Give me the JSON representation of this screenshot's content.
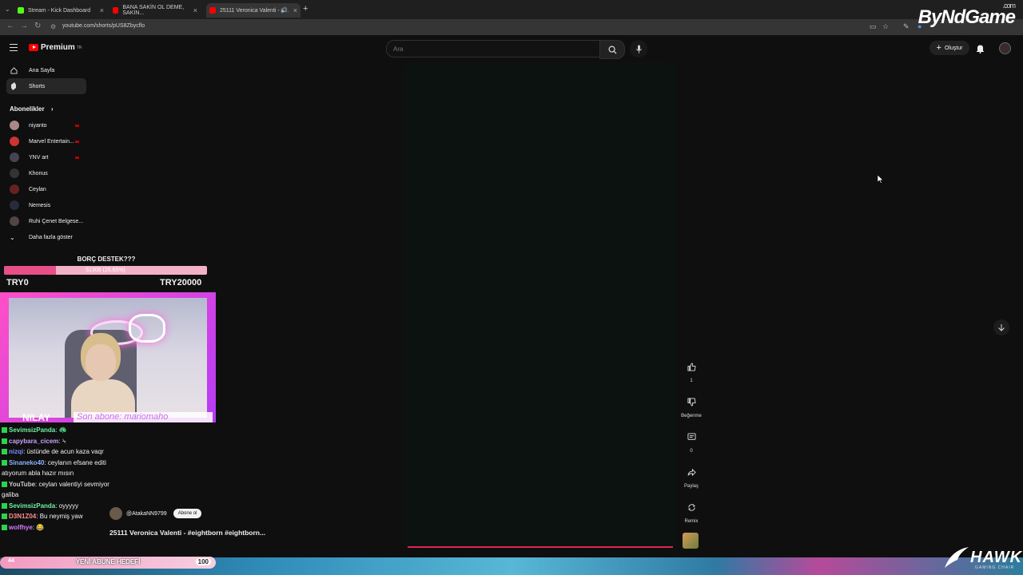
{
  "browser": {
    "tabs": [
      {
        "title": "Stream - Kick Dashboard",
        "fav_color": "#53fc18",
        "close": "×"
      },
      {
        "title": "BANA SAKİN OL DEME, SAKİN...",
        "fav_color": "#ff0000",
        "close": "×"
      },
      {
        "title": "25111 Veronica Valenti - #...",
        "fav_color": "#ff0000",
        "close": "×"
      }
    ],
    "new_tab": "+",
    "url": "youtube.com/shorts/pUS8Zbycflo"
  },
  "overlay_brand": {
    "main": "ByNdGame",
    "sub": ".com"
  },
  "youtube": {
    "logo_text": "Premium",
    "logo_sup": "TR",
    "search_placeholder": "Ara",
    "create_label": "Oluştur",
    "nav": [
      {
        "label": "Ana Sayfa",
        "icon": "home-icon"
      },
      {
        "label": "Shorts",
        "icon": "shorts-icon"
      }
    ],
    "subs_header": "Abonelikler",
    "subs_chevron": "›",
    "subscriptions": [
      {
        "name": "niyanto",
        "color": "#a88",
        "live": true
      },
      {
        "name": "Marvel Entertain...",
        "color": "#c33",
        "live": true
      },
      {
        "name": "YNV art",
        "color": "#445",
        "live": true
      },
      {
        "name": "Khonus",
        "color": "#333",
        "live": false
      },
      {
        "name": "Ceylan",
        "color": "#622",
        "live": false
      },
      {
        "name": "Nemesis",
        "color": "#2a2a3a",
        "live": false
      },
      {
        "name": "Ruhi Çenet Belgese...",
        "color": "#544",
        "live": false
      }
    ],
    "show_more": "Daha fazla göster"
  },
  "donation": {
    "title": "BORÇ DESTEK???",
    "progress_text": "51306 (25.65%)",
    "fraction": 0.2565,
    "min": "TRY0",
    "max": "TRY20000"
  },
  "cam": {
    "name": "NILAY",
    "latest_sub": "Son abone: mariomaho"
  },
  "chat": [
    {
      "user": "SevimsizPanda",
      "color": "#6ef0a5",
      "msg": ": 🦚"
    },
    {
      "user": "capybara_cicem",
      "color": "#c8a0ff",
      "msg": ": ⍀"
    },
    {
      "user": "nizqi",
      "color": "#7c8bff",
      "msg": ": üstünde de acun kaza vaqr"
    },
    {
      "user": "Sinaneko40",
      "color": "#8fb2ff",
      "msg": ": ceylanın efsane editi"
    },
    {
      "user": "",
      "color": "#fff",
      "msg": "atıyorum abla hazır mısın"
    },
    {
      "user": "YouTube",
      "color": "#ccc",
      "msg": ": ceylan valentiyi sevmiyor"
    },
    {
      "user": "",
      "color": "#fff",
      "msg": "galiba"
    },
    {
      "user": "SevimsizPanda",
      "color": "#6ef0a5",
      "msg": ": oyyyyy"
    },
    {
      "user": "D3N1Z04",
      "color": "#ff8d8d",
      "msg": ": Bu neymiş yaw"
    },
    {
      "user": "wolfhye",
      "color": "#d07cff",
      "msg": ": 😂"
    }
  ],
  "short": {
    "channel": "@AtakaNN9799",
    "subscribe": "Abone ol",
    "title": "25111 Veronica Valenti - #eightborn #eightborn...",
    "progress": 1.0,
    "actions": [
      {
        "icon": "like-icon",
        "label": "1"
      },
      {
        "icon": "dislike-icon",
        "label": "Beğenme"
      },
      {
        "icon": "comment-icon",
        "label": "0"
      },
      {
        "icon": "share-icon",
        "label": "Paylaş"
      },
      {
        "icon": "remix-icon",
        "label": "Remix"
      }
    ]
  },
  "sub_goal": {
    "current": "44",
    "label": "YENİ ABUNE HEDEFİ",
    "target": "100"
  },
  "hawk": {
    "name": "HAWK",
    "tag": "GAMING CHAIR"
  }
}
